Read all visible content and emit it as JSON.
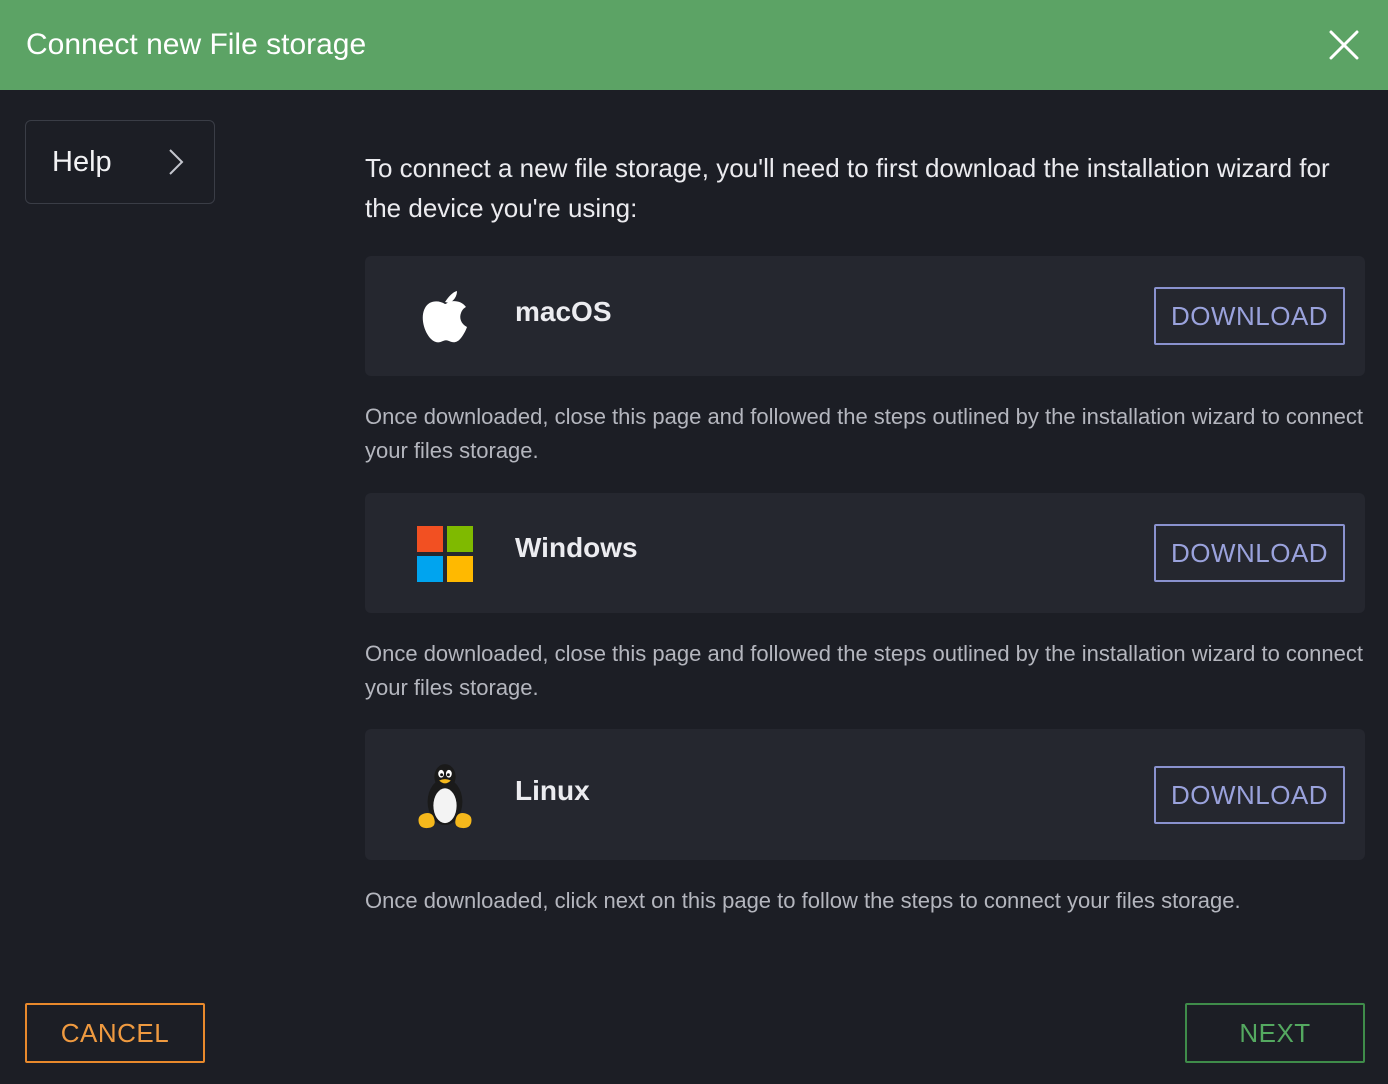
{
  "dialog": {
    "title": "Connect new File storage",
    "close_icon": "close-icon"
  },
  "sidebar": {
    "help_label": "Help",
    "help_icon": "chevron-right-icon"
  },
  "intro_text": "To connect a new file storage, you'll need to first download the installation wizard for the device you're using:",
  "platforms": [
    {
      "name": "macOS",
      "icon": "apple-icon",
      "button_label": "DOWNLOAD",
      "note": "Once downloaded, close this page and followed the steps outlined by the installation wizard to connect your files storage."
    },
    {
      "name": "Windows",
      "icon": "windows-icon",
      "button_label": "DOWNLOAD",
      "note": "Once downloaded, close this page and followed the steps outlined by the installation wizard to connect your files storage."
    },
    {
      "name": "Linux",
      "icon": "linux-tux-icon",
      "button_label": "DOWNLOAD",
      "note": "Once downloaded, click next on this page to follow the steps to connect your files storage."
    }
  ],
  "footer": {
    "cancel_label": "CANCEL",
    "next_label": "NEXT"
  },
  "colors": {
    "header_bg": "#5ca365",
    "page_bg": "#1c1e25",
    "card_bg": "#25272f",
    "download_accent": "#8a92cf",
    "cancel_accent": "#e8892c",
    "next_accent": "#3f8c4a"
  }
}
